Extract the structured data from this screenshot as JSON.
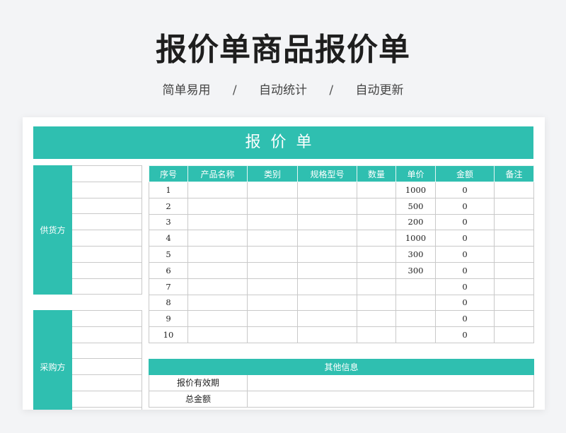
{
  "page": {
    "title": "报价单商品报价单",
    "tags": [
      "简单易用",
      "自动统计",
      "自动更新"
    ]
  },
  "sheet": {
    "banner": "报价单",
    "supplier_label": "供货方",
    "buyer_label": "采购方",
    "columns": [
      "序号",
      "产品名称",
      "类别",
      "规格型号",
      "数量",
      "单价",
      "金额",
      "备注"
    ],
    "rows": [
      {
        "no": "1",
        "price": "1000",
        "amount": "0"
      },
      {
        "no": "2",
        "price": "500",
        "amount": "0"
      },
      {
        "no": "3",
        "price": "200",
        "amount": "0"
      },
      {
        "no": "4",
        "price": "1000",
        "amount": "0"
      },
      {
        "no": "5",
        "price": "300",
        "amount": "0"
      },
      {
        "no": "6",
        "price": "300",
        "amount": "0"
      },
      {
        "no": "7",
        "price": "",
        "amount": "0"
      },
      {
        "no": "8",
        "price": "",
        "amount": "0"
      },
      {
        "no": "9",
        "price": "",
        "amount": "0"
      },
      {
        "no": "10",
        "price": "",
        "amount": "0"
      }
    ],
    "other_info": {
      "header": "其他信息",
      "validity_label": "报价有效期",
      "total_label": "总金额"
    }
  },
  "colors": {
    "accent": "#2fbfb0",
    "background": "#f3f4f6"
  }
}
